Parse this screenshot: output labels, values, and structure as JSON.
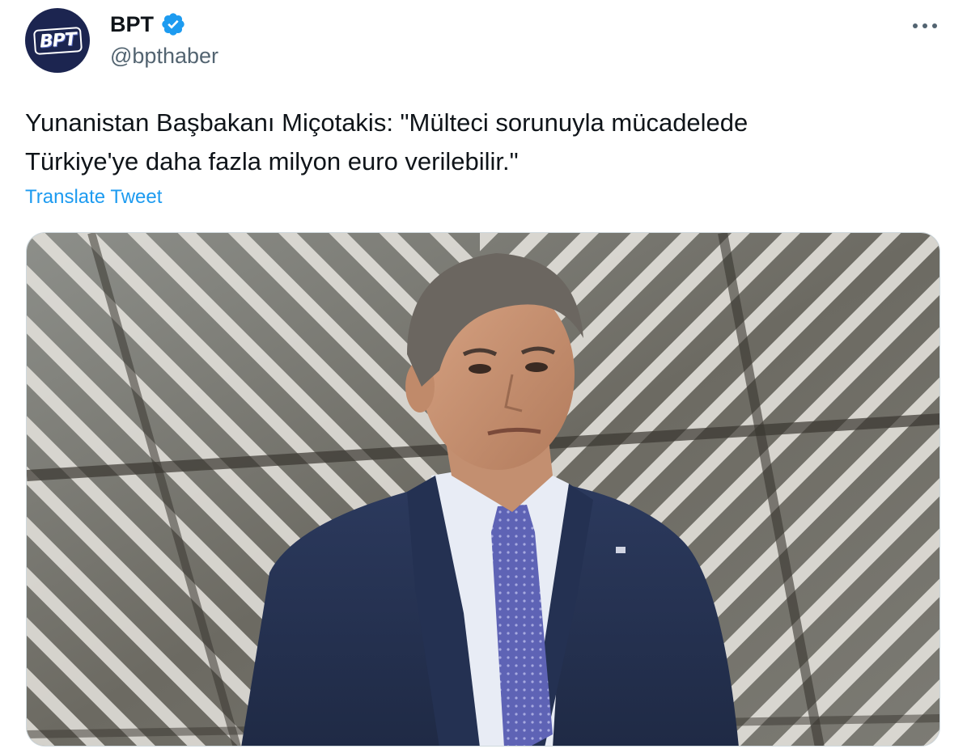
{
  "author": {
    "display_name": "BPT",
    "handle": "@bpthaber",
    "avatar_text": "BPT",
    "verified": true
  },
  "tweet": {
    "text_lines": [
      "Yunanistan Başbakanı Miçotakis: \"Mülteci sorunuyla mücadelede",
      "Türkiye'ye daha fazla milyon euro verilebilir.\""
    ],
    "translate_label": "Translate Tweet"
  },
  "icons": {
    "verified": "verified-badge-icon",
    "more": "more-options-icon"
  },
  "colors": {
    "link": "#1d9bf0",
    "secondary_text": "#536471",
    "avatar_bg": "#1c2550",
    "verified": "#1d9bf0"
  }
}
